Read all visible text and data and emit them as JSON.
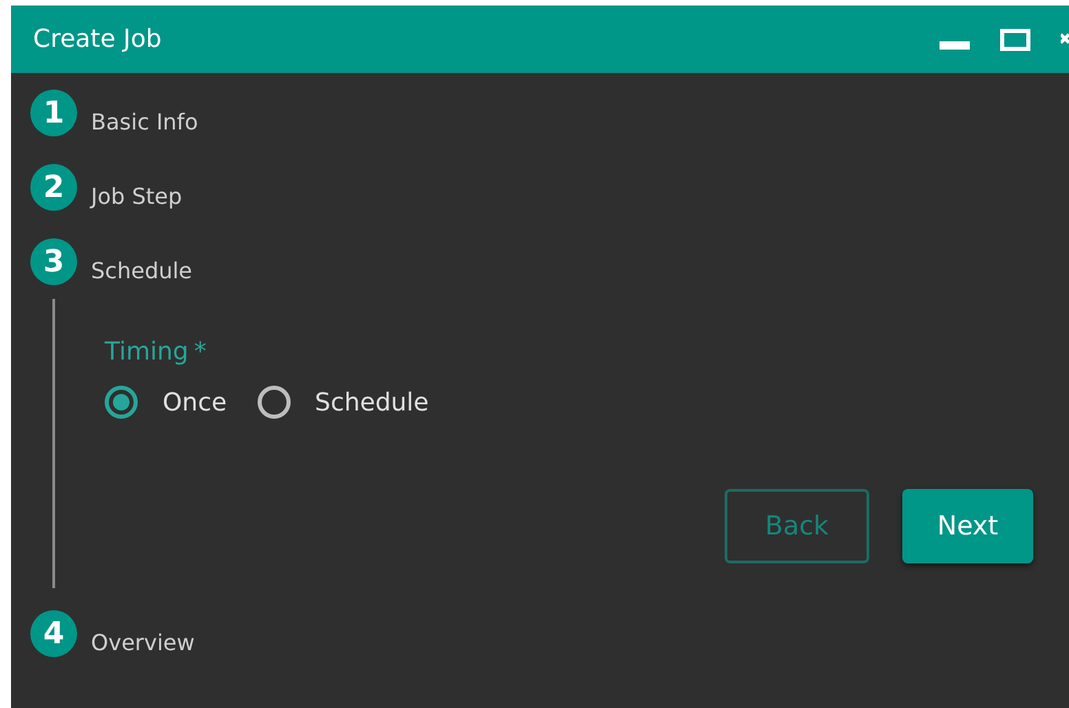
{
  "window": {
    "title": "Create Job"
  },
  "steps": [
    {
      "number": "1",
      "label": "Basic Info",
      "expanded": false
    },
    {
      "number": "2",
      "label": "Job Step",
      "expanded": false
    },
    {
      "number": "3",
      "label": "Schedule",
      "expanded": true
    },
    {
      "number": "4",
      "label": "Overview",
      "expanded": false
    }
  ],
  "form": {
    "field_label": "Timing",
    "required_mark": "*",
    "options": [
      {
        "label": "Once",
        "selected": true
      },
      {
        "label": "Schedule",
        "selected": false
      }
    ],
    "buttons": [
      {
        "label": "Back",
        "kind": "outline"
      },
      {
        "label": "Next",
        "kind": "primary"
      }
    ]
  }
}
